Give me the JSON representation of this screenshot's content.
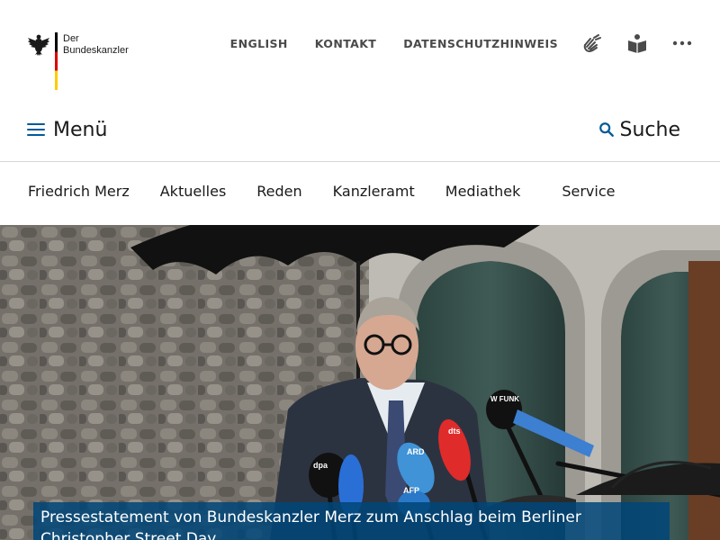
{
  "branding": {
    "line1": "Der",
    "line2": "Bundeskanzler"
  },
  "utility_nav": [
    {
      "label": "ENGLISH"
    },
    {
      "label": "KONTAKT"
    },
    {
      "label": "DATENSCHUTZHINWEIS"
    }
  ],
  "utility_icons": [
    "sign-language-icon",
    "easy-language-icon",
    "more-icon"
  ],
  "menu": {
    "label": "Menü"
  },
  "search": {
    "label": "Suche"
  },
  "main_nav": [
    {
      "label": "Friedrich Merz"
    },
    {
      "label": "Aktuelles"
    },
    {
      "label": "Reden"
    },
    {
      "label": "Kanzleramt"
    },
    {
      "label": "Mediathek"
    },
    {
      "label": "Service"
    }
  ],
  "hero": {
    "caption": "Pressestatement von Bundeskanzler Merz zum Anschlag beim Berliner Christopher Street Day",
    "mic_labels": [
      "dpa",
      "AFP",
      "dts",
      "ARD",
      "W FUNK"
    ]
  },
  "colors": {
    "accent": "#005a96",
    "caption_bg": "#00467a",
    "text": "#1a1a1a"
  }
}
